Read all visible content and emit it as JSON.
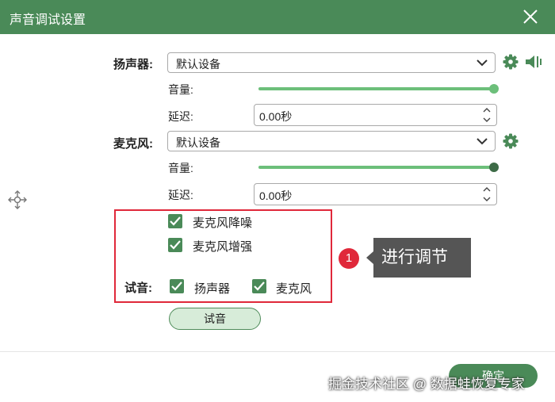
{
  "window": {
    "title": "声音调试设置"
  },
  "speaker": {
    "label": "扬声器:",
    "device": "默认设备",
    "volume_label": "音量:",
    "volume": 1.0,
    "delay_label": "延迟:",
    "delay": "0.00秒"
  },
  "mic": {
    "label": "麦克风:",
    "device": "默认设备",
    "volume_label": "音量:",
    "volume": 1.0,
    "delay_label": "延迟:",
    "delay": "0.00秒"
  },
  "options": {
    "noise_reduction": {
      "label": "麦克风降噪",
      "checked": true
    },
    "mic_boost": {
      "label": "麦克风增强",
      "checked": true
    },
    "test_label": "试音:",
    "test_speaker": {
      "label": "扬声器",
      "checked": true
    },
    "test_mic": {
      "label": "麦克风",
      "checked": true
    }
  },
  "annotation": {
    "badge": "1",
    "text": "进行调节"
  },
  "buttons": {
    "trial": "试音",
    "ok": "确定"
  },
  "watermark": "掘金技术社区 @ 数据蛙恢复专家",
  "colors": {
    "accent": "#4a8a58",
    "slider": "#6cbf7a",
    "highlight": "#e0283a"
  }
}
